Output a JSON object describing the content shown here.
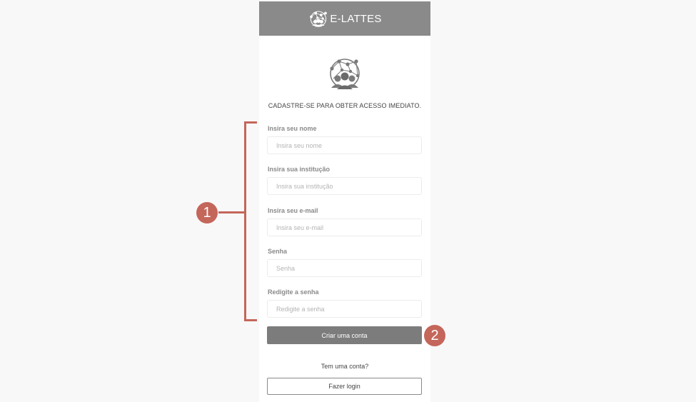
{
  "header": {
    "brand": "E-LATTES",
    "logo_icon": "globe-network-people-icon"
  },
  "logo_icon": "globe-network-people-icon",
  "subtitle": "CADASTRE-SE PARA OBTER ACESSO IMEDIATO.",
  "form": {
    "fields": [
      {
        "label": "Insira seu nome",
        "placeholder": "Insira seu nome",
        "value": ""
      },
      {
        "label": "Insira sua institução",
        "placeholder": "Insira sua institução",
        "value": ""
      },
      {
        "label": "Insira seu e-mail",
        "placeholder": "Insira seu e-mail",
        "value": ""
      },
      {
        "label": "Senha",
        "placeholder": "Senha",
        "value": ""
      },
      {
        "label": "Redigite a senha",
        "placeholder": "Redigite a senha",
        "value": ""
      }
    ],
    "submit_label": "Criar uma conta"
  },
  "login": {
    "prompt": "Tem uma conta?",
    "button_label": "Fazer login"
  },
  "annotations": {
    "marker_1": "1",
    "marker_2": "2",
    "color": "#c4665a"
  },
  "colors": {
    "header_bg": "#8a8a8a",
    "primary_button": "#7c7c7c",
    "page_bg": "#f8f8f8"
  }
}
